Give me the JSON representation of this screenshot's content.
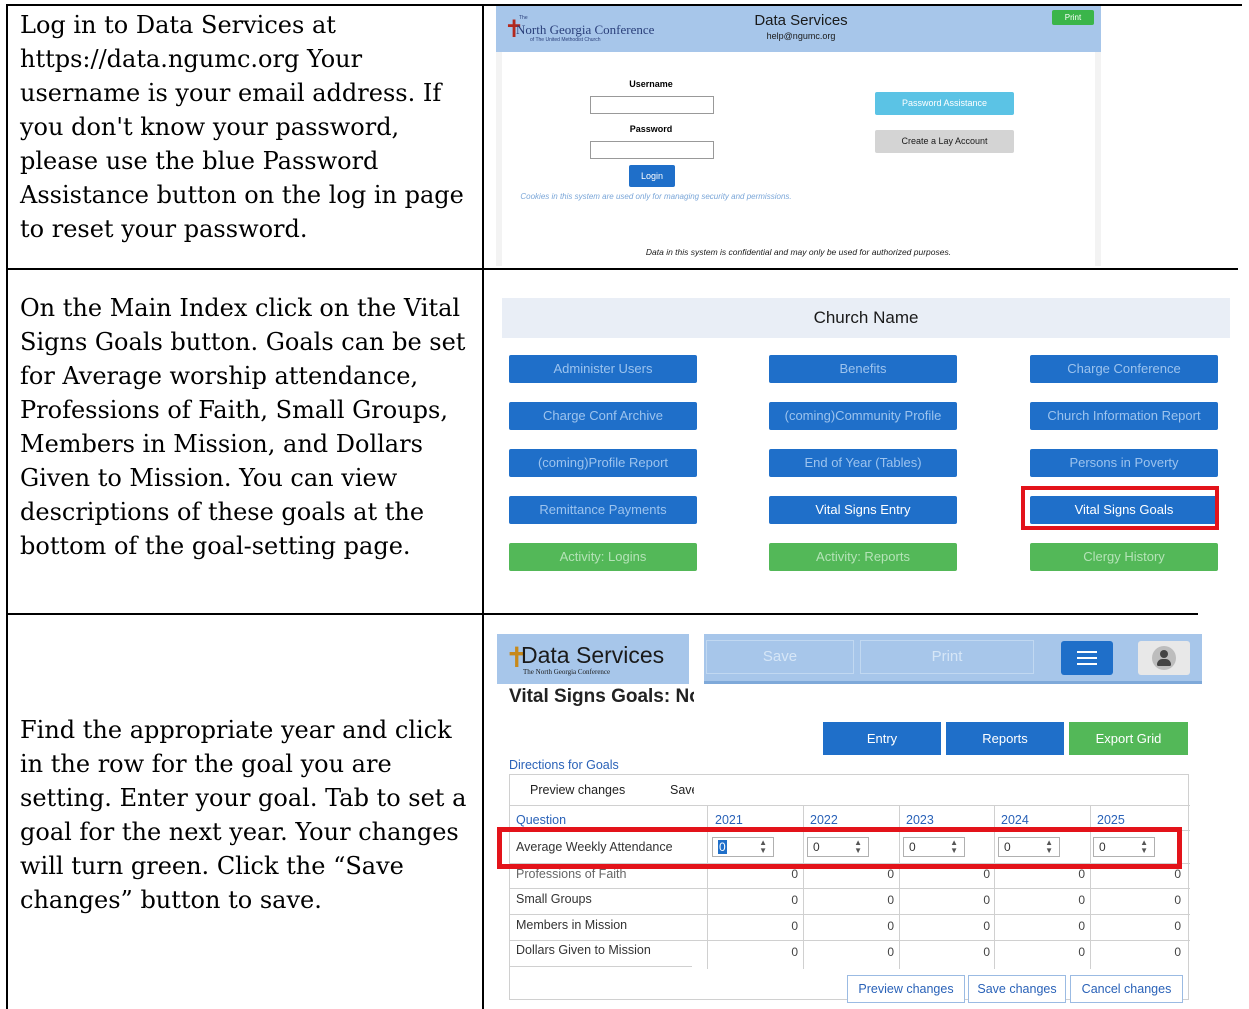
{
  "rows": [
    {
      "instruction": "Log in to Data Services at https://data.ngumc.org Your username is your email address. If you don't know your password, please use the blue Password Assistance button on the log in page to reset your password."
    },
    {
      "instruction": "On the Main Index click on the Vital Signs Goals button. Goals can be set for Average worship attendance, Professions of Faith, Small Groups, Members in Mission, and Dollars Given to Mission. You can view descriptions of these goals at the bottom of the  goal-setting page."
    },
    {
      "instruction": "Find the appropriate year and click in the row for the goal you are setting. Enter your goal. Tab to set a goal for the next year. Your changes will turn green. Click the “Save changes” button to save."
    }
  ],
  "login_screen": {
    "logo_name": "North Georgia Conference",
    "logo_small": "of The United Methodist Church",
    "logo_the": "The",
    "title": "Data Services",
    "email": "help@ngumc.org",
    "print_label": "Print",
    "username_label": "Username",
    "password_label": "Password",
    "login_label": "Login",
    "cookie_note": "Cookies in this system are used only for managing security and permissions.",
    "password_assistance_label": "Password Assistance",
    "lay_account_label": "Create a Lay Account",
    "confidential_note": "Data in this system is confidential and may only be used for authorized purposes."
  },
  "main_index": {
    "church_name": "Church Name",
    "buttons": [
      {
        "label": "Administer Users",
        "color": "blue"
      },
      {
        "label": "Benefits",
        "color": "blue"
      },
      {
        "label": "Charge Conference",
        "color": "blue"
      },
      {
        "label": "Charge Conf Archive",
        "color": "blue"
      },
      {
        "label": "(coming)Community Profile",
        "color": "blue"
      },
      {
        "label": "Church Information Report",
        "color": "blue"
      },
      {
        "label": "(coming)Profile Report",
        "color": "blue"
      },
      {
        "label": "End of Year (Tables)",
        "color": "blue"
      },
      {
        "label": "Persons in Poverty",
        "color": "blue"
      },
      {
        "label": "Remittance Payments",
        "color": "blue"
      },
      {
        "label": "Vital Signs Entry",
        "color": "blue"
      },
      {
        "label": "Vital Signs Goals",
        "color": "blue"
      },
      {
        "label": "Activity: Logins",
        "color": "green"
      },
      {
        "label": "Activity: Reports",
        "color": "green"
      },
      {
        "label": "Clergy History",
        "color": "green"
      }
    ]
  },
  "goals_screen": {
    "logo_name": "Data Services",
    "logo_sub": "The North Georgia Conference",
    "toolbar_save": "Save",
    "toolbar_print": "Print",
    "page_title": "Vital Signs Goals: Nor",
    "entry_label": "Entry",
    "reports_label": "Reports",
    "export_label": "Export Grid",
    "directions_link": "Directions for Goals",
    "preview_tab": "Preview changes",
    "save_tab": "Save",
    "question_header": "Question",
    "years": [
      "2021",
      "2022",
      "2023",
      "2024",
      "2025"
    ],
    "row_labels": [
      "Average Weekly Attendance",
      "Professions of Faith",
      "Small Groups",
      "Members in Mission",
      "Dollars Given to Mission"
    ],
    "cell_value": "0",
    "preview_changes": "Preview changes",
    "save_changes": "Save changes",
    "cancel_changes": "Cancel changes"
  },
  "colors": {
    "header_blue": "#a7c6ea",
    "button_blue": "#1f6fc9",
    "button_green": "#53b858",
    "highlight_red": "#e3131a"
  }
}
